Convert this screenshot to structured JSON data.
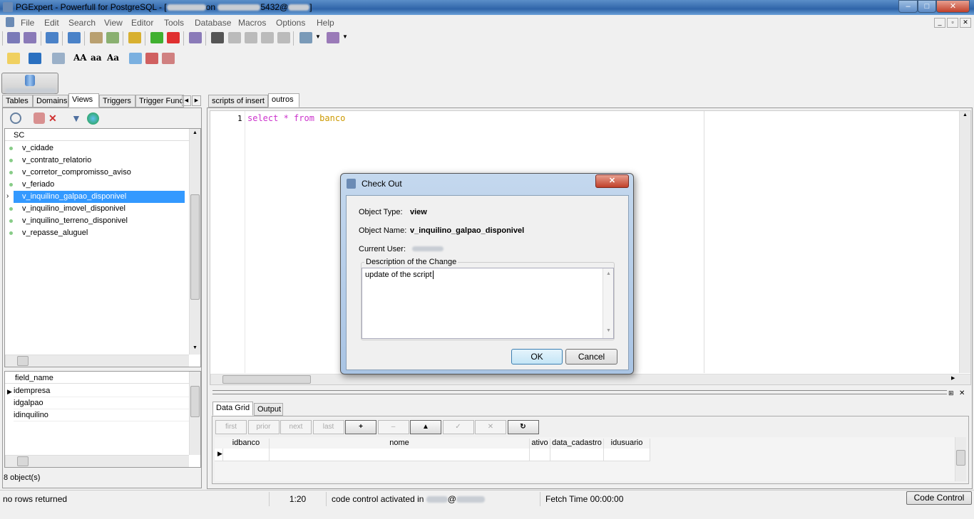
{
  "window": {
    "title": "PGExpert - Powerfull for PostgreSQL - [",
    "title_mid": "on",
    "title_port": "5432@",
    "title_end": "]",
    "minimize": "–",
    "maximize": "□",
    "close": "✕"
  },
  "menu": [
    "File",
    "Edit",
    "Search",
    "View",
    "Editor",
    "Tools",
    "Database",
    "Macros",
    "Options",
    "Help"
  ],
  "toolbar1": [
    {
      "icon": "connect-icon",
      "color": "#7a7ab8"
    },
    {
      "icon": "disconnect-icon",
      "color": "#8a7ab8"
    },
    {
      "icon": "database-add-icon",
      "color": "#4a82c8"
    },
    {
      "icon": "database-remove-icon",
      "color": "#4a82c8"
    },
    {
      "icon": "script-import-icon",
      "color": "#b9a070"
    },
    {
      "icon": "script-export-icon",
      "color": "#8ab070"
    },
    {
      "icon": "query-builder-icon",
      "color": "#d8b030"
    },
    {
      "icon": "thumbs-up-icon",
      "color": "#40b030"
    },
    {
      "icon": "thumbs-down-icon",
      "color": "#e03030"
    },
    {
      "icon": "refresh-connection-icon",
      "color": "#8a7ab8"
    },
    {
      "icon": "record-icon",
      "color": "#555"
    },
    {
      "icon": "macro-icon",
      "color": "#bbb"
    },
    {
      "icon": "macro-icon",
      "color": "#bbb"
    },
    {
      "icon": "macro-icon",
      "color": "#bbb"
    },
    {
      "icon": "macro-icon",
      "color": "#bbb"
    },
    {
      "icon": "plugin-add-icon",
      "color": "#7a9ab8"
    },
    {
      "icon": "plugin-remove-icon",
      "color": "#9a7ab8"
    }
  ],
  "toolbar2": [
    {
      "icon": "open-folder-icon",
      "color": "#f0d060"
    },
    {
      "icon": "save-icon",
      "color": "#2a70c0"
    },
    {
      "icon": "print-icon",
      "color": "#9ab0c8"
    },
    {
      "icon": "uppercase-icon",
      "label": "AA"
    },
    {
      "icon": "lowercase-icon",
      "label": "aa"
    },
    {
      "icon": "capitalize-icon",
      "label": "Aa"
    },
    {
      "icon": "folder-icon",
      "color": "#7ab0e0"
    },
    {
      "icon": "folder-delete-icon",
      "color": "#d06060"
    },
    {
      "icon": "folder-remove-icon",
      "color": "#d08080"
    }
  ],
  "left": {
    "tabs": [
      "Tables",
      "Domains",
      "Views",
      "Triggers",
      "Trigger Func"
    ],
    "active_tab": "Views",
    "schema": "SC",
    "items": [
      "v_cidade",
      "v_contrato_relatorio",
      "v_corretor_compromisso_aviso",
      "v_feriado",
      "v_inquilino_galpao_disponivel",
      "v_inquilino_imovel_disponivel",
      "v_inquilino_terreno_disponivel",
      "v_repasse_aluguel"
    ],
    "selected": "v_inquilino_galpao_disponivel",
    "fields_header": "field_name",
    "fields": [
      "idempresa",
      "idgalpao",
      "idinquilino"
    ],
    "count": "8 object(s)"
  },
  "editor": {
    "tabs": [
      "scripts of insert",
      "outros"
    ],
    "active_tab": "outros",
    "line_no": "1",
    "code": [
      {
        "t": "select",
        "c": "#cc33cc"
      },
      {
        "t": " * ",
        "c": "#cc33cc"
      },
      {
        "t": "from",
        "c": "#cc33cc"
      },
      {
        "t": " banco",
        "c": "#cc9900"
      }
    ]
  },
  "results": {
    "tabs": [
      "Data Grid",
      "Output"
    ],
    "buttons": [
      "first",
      "prior",
      "next",
      "last",
      "+",
      "–",
      "▲",
      "✓",
      "✕",
      "↻"
    ],
    "columns": [
      "idbanco",
      "nome",
      "ativo",
      "data_cadastro",
      "idusuario"
    ]
  },
  "status": {
    "message": "no rows returned",
    "position": "1:20",
    "code_control": "code control activated in",
    "at": "@",
    "fetch": "Fetch Time 00:00:00",
    "button": "Code Control"
  },
  "dialog": {
    "title": "Check Out",
    "close": "✕",
    "type_label": "Object Type:",
    "type_value": "view",
    "name_label": "Object Name:",
    "name_value": "v_inquilino_galpao_disponivel",
    "user_label": "Current User:",
    "desc_label": "Description of the Change",
    "desc_value": "update of the script",
    "ok": "OK",
    "cancel": "Cancel"
  }
}
